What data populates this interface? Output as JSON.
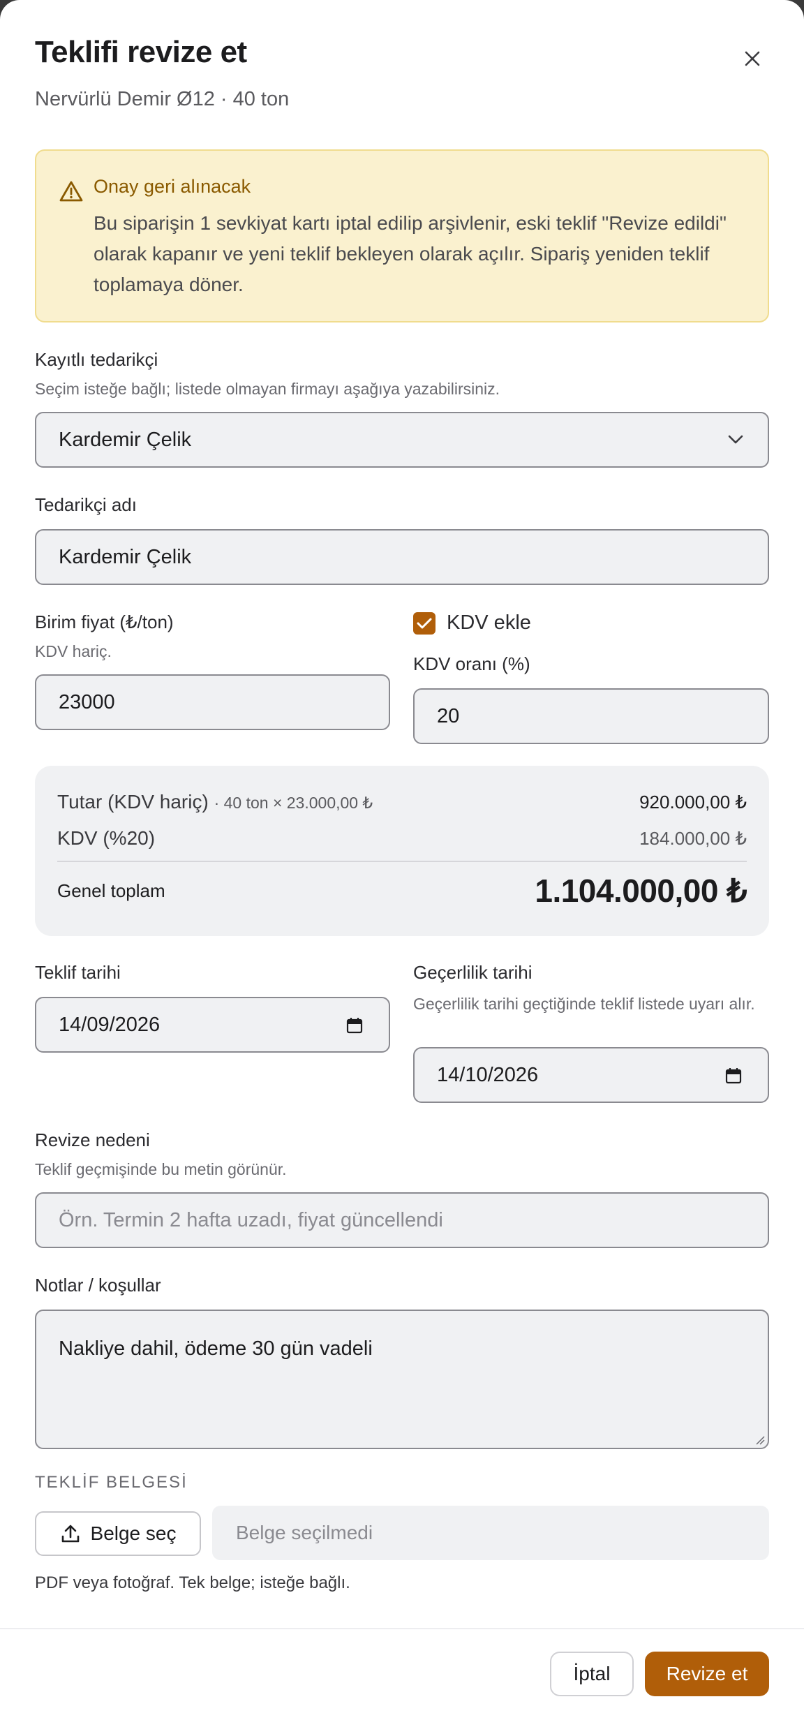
{
  "modal": {
    "title": "Teklifi revize et",
    "subtitle": "Nervürlü Demir Ø12 · 40 ton"
  },
  "alert": {
    "title": "Onay geri alınacak",
    "body": "Bu siparişin 1 sevkiyat kartı iptal edilip arşivlenir, eski teklif \"Revize edildi\" olarak kapanır ve yeni teklif bekleyen olarak açılır. Sipariş yeniden teklif toplamaya döner."
  },
  "supplier_select": {
    "label": "Kayıtlı tedarikçi",
    "help": "Seçim isteğe bağlı; listede olmayan firmayı aşağıya yazabilirsiniz.",
    "value": "Kardemir Çelik"
  },
  "supplier_name": {
    "label": "Tedarikçi adı",
    "value": "Kardemir Çelik"
  },
  "unit_price": {
    "label": "Birim fiyat (₺/ton)",
    "help": "KDV hariç.",
    "value": "23000"
  },
  "vat": {
    "checkbox_label": "KDV ekle",
    "checked": true,
    "rate_label": "KDV oranı (%)",
    "rate_value": "20"
  },
  "summary": {
    "net_label": "Tutar (KDV hariç)",
    "net_detail": "· 40 ton × 23.000,00 ₺",
    "net_value": "920.000,00 ₺",
    "vat_label": "KDV (%20)",
    "vat_value": "184.000,00 ₺",
    "total_label": "Genel toplam",
    "total_value": "1.104.000,00 ₺"
  },
  "offer_date": {
    "label": "Teklif tarihi",
    "value": "14/09/2026"
  },
  "validity_date": {
    "label": "Geçerlilik tarihi",
    "help": "Geçerlilik tarihi geçtiğinde teklif listede uyarı alır.",
    "value": "14/10/2026"
  },
  "revision_reason": {
    "label": "Revize nedeni",
    "help": "Teklif geçmişinde bu metin görünür.",
    "placeholder": "Örn. Termin 2 hafta uzadı, fiyat güncellendi",
    "value": ""
  },
  "notes": {
    "label": "Notlar / koşullar",
    "value": "Nakliye dahil, ödeme 30 gün vadeli"
  },
  "document": {
    "section_title": "TEKLİF BELGESİ",
    "button_label": "Belge seç",
    "status": "Belge seçilmedi",
    "help": "PDF veya fotoğraf. Tek belge; isteğe bağlı."
  },
  "footer": {
    "cancel_label": "İptal",
    "submit_label": "Revize et"
  },
  "colors": {
    "accent": "#b05e09",
    "alert_bg": "#faf1cf",
    "alert_border": "#f0dc8e",
    "field_bg": "#f0f1f3"
  }
}
